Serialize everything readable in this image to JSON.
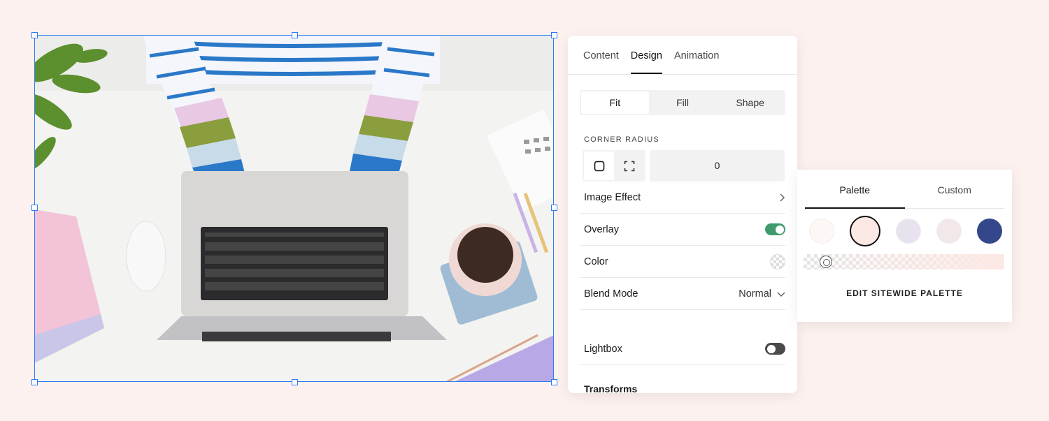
{
  "design_panel": {
    "tabs": [
      {
        "label": "Content"
      },
      {
        "label": "Design"
      },
      {
        "label": "Animation"
      }
    ],
    "active_tab": "Design",
    "fit_modes": [
      {
        "label": "Fit"
      },
      {
        "label": "Fill"
      },
      {
        "label": "Shape"
      }
    ],
    "active_fit_mode": "Fit",
    "corner_radius": {
      "label": "CORNER RADIUS",
      "value": "0"
    },
    "image_effect_label": "Image Effect",
    "overlay": {
      "label": "Overlay",
      "enabled": true
    },
    "color_label": "Color",
    "blend_mode": {
      "label": "Blend Mode",
      "value": "Normal"
    },
    "lightbox": {
      "label": "Lightbox",
      "enabled": false
    },
    "transforms_label": "Transforms"
  },
  "color_popover": {
    "tabs": [
      {
        "label": "Palette"
      },
      {
        "label": "Custom"
      }
    ],
    "active_tab": "Palette",
    "swatches": [
      "#fdf7f5",
      "#fce8e4",
      "#e8e2ee",
      "#f2e8ea",
      "#34478a"
    ],
    "selected_swatch": 1,
    "edit_button_label": "EDIT SITEWIDE PALETTE"
  },
  "colors": {
    "background": "#fcf1ef",
    "selection": "#2f7bf5",
    "toggle_on": "#3f9a6d",
    "toggle_off": "#4a4a4a"
  }
}
